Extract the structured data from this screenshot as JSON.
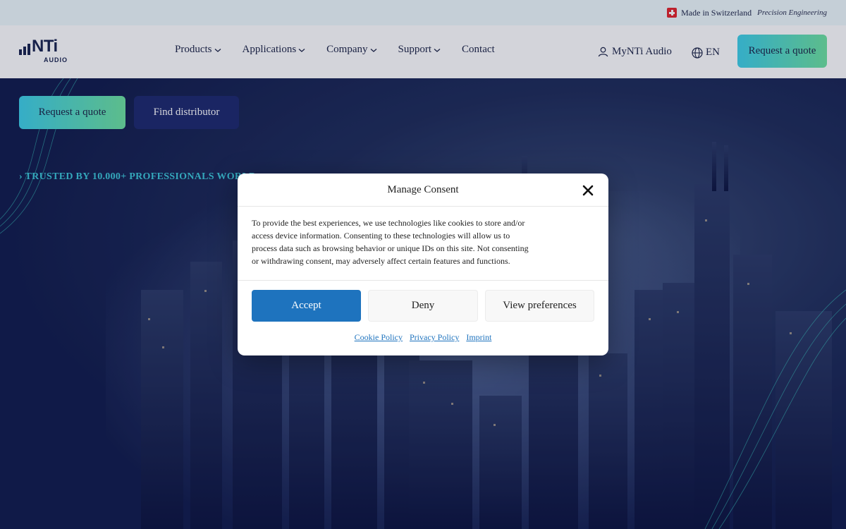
{
  "topbar": {
    "made_in": "Made in Switzerland",
    "tagline": "Precision Engineering"
  },
  "header": {
    "logo_word": "NTi",
    "logo_sub": "AUDIO",
    "nav": [
      {
        "label": "Products"
      },
      {
        "label": "Applications"
      },
      {
        "label": "Company"
      },
      {
        "label": "Support"
      },
      {
        "label": "Contact"
      }
    ],
    "account_label": "MyNTi Audio",
    "language": "EN",
    "quote_label": "Request a quote"
  },
  "hero": {
    "primary_button": "Request a quote",
    "secondary_button": "Find distributor",
    "trusted_text": "TRUSTED BY 10.000+ PROFESSIONALS WORLD"
  },
  "consent": {
    "title": "Manage Consent",
    "body": "To provide the best experiences, we use technologies like cookies to store and/or access device information. Consenting to these technologies will allow us to process data such as browsing behavior or unique IDs on this site. Not consenting or withdrawing consent, may adversely affect certain features and functions.",
    "accept_label": "Accept",
    "deny_label": "Deny",
    "preferences_label": "View preferences",
    "links": {
      "cookie": "Cookie Policy",
      "privacy": "Privacy Policy",
      "imprint": "Imprint"
    }
  },
  "colors": {
    "accent_gradient_start": "#3fd0e8",
    "accent_gradient_end": "#6fe3a0",
    "navy": "#1d2547",
    "accept_blue": "#1e73be"
  }
}
